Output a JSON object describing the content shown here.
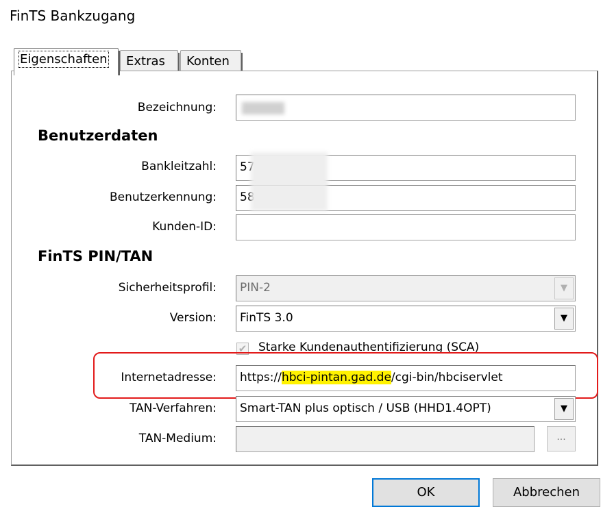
{
  "window": {
    "title": "FinTS Bankzugang"
  },
  "tabs": [
    {
      "label": "Eigenschaften"
    },
    {
      "label": "Extras"
    },
    {
      "label": "Konten"
    }
  ],
  "form": {
    "bezeichnung_label": "Bezeichnung:",
    "section_benutzerdaten": "Benutzerdaten",
    "bankleitzahl_label": "Bankleitzahl:",
    "bankleitzahl_value": "57",
    "benutzerkennung_label": "Benutzerkennung:",
    "benutzerkennung_value": "58",
    "kunden_id_label": "Kunden-ID:",
    "kunden_id_value": "",
    "section_fints": "FinTS PIN/TAN",
    "sicherheitsprofil_label": "Sicherheitsprofil:",
    "sicherheitsprofil_value": "PIN-2",
    "version_label": "Version:",
    "version_value": "FinTS 3.0",
    "sca_label": "Starke Kundenauthentifizierung (SCA)",
    "sca_checked": true,
    "internetadresse_label": "Internetadresse:",
    "url_prefix": "https://",
    "url_host": "hbci-pintan.gad.de",
    "url_suffix": "/cgi-bin/hbciservlet",
    "tan_verfahren_label": "TAN-Verfahren:",
    "tan_verfahren_value": "Smart-TAN plus optisch / USB (HHD1.4OPT)",
    "tan_medium_label": "TAN-Medium:",
    "tan_medium_value": "",
    "browse_label": "..."
  },
  "buttons": {
    "ok": "OK",
    "cancel": "Abbrechen"
  },
  "colors": {
    "highlight": "#fff200",
    "annotation_box": "#e21a1a",
    "default_button_border": "#0078d7"
  }
}
